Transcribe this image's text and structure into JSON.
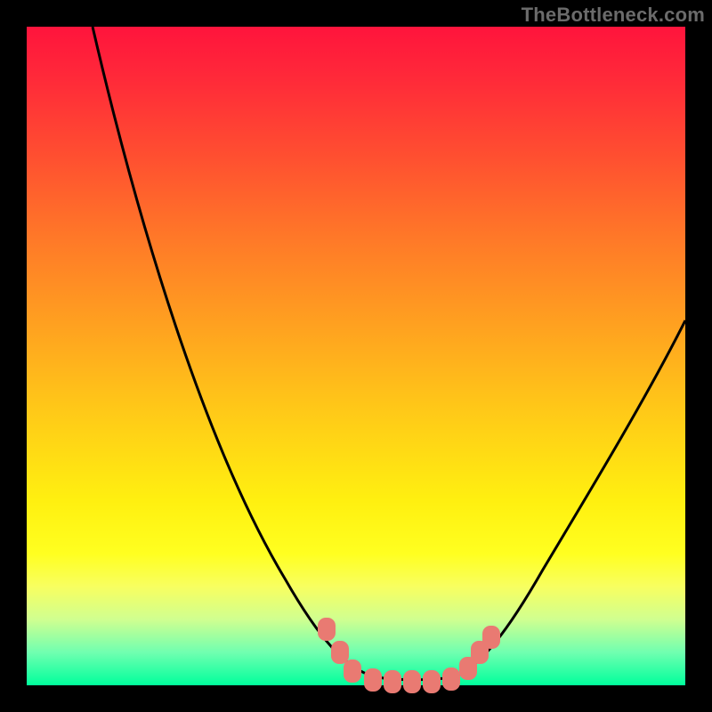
{
  "watermark": "TheBottleneck.com",
  "colors": {
    "frame": "#000000",
    "curve": "#000000",
    "marker": "#e97a72",
    "gradient_top": "#ff143c",
    "gradient_bottom": "#00ff9c"
  },
  "chart_data": {
    "type": "line",
    "title": "",
    "xlabel": "",
    "ylabel": "",
    "xlim": [
      0,
      100
    ],
    "ylim": [
      0,
      100
    ],
    "grid": false,
    "legend": false,
    "annotations": [
      "TheBottleneck.com"
    ],
    "series": [
      {
        "name": "bottleneck-curve-left",
        "x": [
          10,
          15,
          20,
          25,
          30,
          35,
          40,
          45,
          48,
          50,
          52
        ],
        "values": [
          100,
          86,
          72,
          58,
          44,
          31,
          19,
          9,
          4,
          2,
          1
        ]
      },
      {
        "name": "bottleneck-curve-right",
        "x": [
          65,
          68,
          72,
          76,
          80,
          85,
          90,
          95,
          100
        ],
        "values": [
          1,
          3,
          8,
          14,
          21,
          30,
          39,
          48,
          56
        ]
      },
      {
        "name": "flat-bottom",
        "x": [
          52,
          55,
          58,
          61,
          64,
          65
        ],
        "values": [
          1,
          0.5,
          0.5,
          0.5,
          0.5,
          1
        ]
      }
    ],
    "markers": [
      {
        "x": 45.5,
        "y": 8.5
      },
      {
        "x": 47.5,
        "y": 5.0
      },
      {
        "x": 49.5,
        "y": 2.2
      },
      {
        "x": 52.5,
        "y": 0.8
      },
      {
        "x": 55.5,
        "y": 0.6
      },
      {
        "x": 58.5,
        "y": 0.6
      },
      {
        "x": 61.5,
        "y": 0.6
      },
      {
        "x": 64.5,
        "y": 0.9
      },
      {
        "x": 67.0,
        "y": 2.6
      },
      {
        "x": 68.8,
        "y": 5.0
      },
      {
        "x": 70.5,
        "y": 7.3
      }
    ]
  }
}
